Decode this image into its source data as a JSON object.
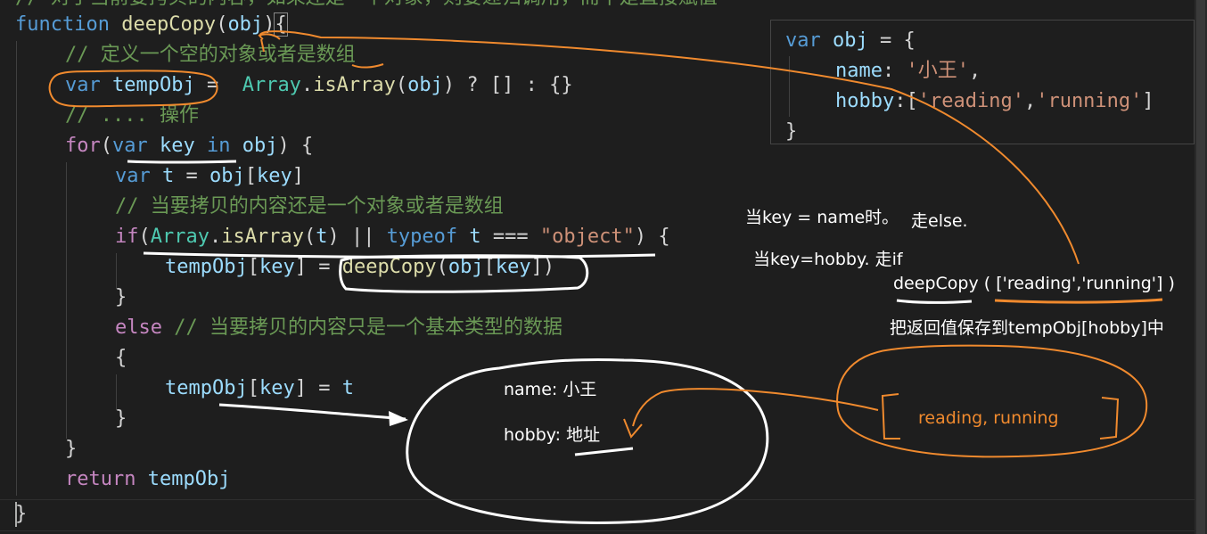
{
  "code": {
    "line0": "// 对于当前要拷贝的内容，如果还是一个对象，则要递归调用，而不是直接赋值",
    "line1": {
      "kw": "function",
      "fn": "deepCopy",
      "p1": "(",
      "v": "obj",
      "p2": ")",
      "brace": "{"
    },
    "line2": "// 定义一个空的对象或者是数组",
    "line3": {
      "kw": "var",
      "v": "tempObj",
      "op": " =  ",
      "cls": "Array",
      "dot": ".",
      "fn": "isArray",
      "p1": "(",
      "v2": "obj",
      "rest": ") ? [] : {}"
    },
    "line4": "// .... 操作",
    "line5": {
      "ctl": "for",
      "p1": "(",
      "kw": "var",
      "v": "key",
      "in": "in",
      "v2": "obj",
      "rest": ") {"
    },
    "line6": {
      "kw": "var",
      "v": "t",
      "op": " = ",
      "v2": "obj",
      "b1": "[",
      "v3": "key",
      "b2": "]"
    },
    "line7": "// 当要拷贝的内容还是一个对象或者是数组",
    "line8": {
      "ctl": "if",
      "p1": "(",
      "cls": "Array",
      "dot": ".",
      "fn": "isArray",
      "p2": "(",
      "v": "t",
      "p3": ") || ",
      "kw": "typeof",
      "v2": "t",
      "op": " === ",
      "str": "\"object\"",
      "rest": ") {"
    },
    "line9": {
      "v": "tempObj",
      "b1": "[",
      "v2": "key",
      "b2": "] = ",
      "fn": "deepCopy",
      "p1": "(",
      "v3": "obj",
      "b3": "[",
      "v4": "key",
      "rest": "])"
    },
    "line10": "}",
    "line11": {
      "ctl": "else",
      "cm": " // 当要拷贝的内容只是一个基本类型的数据"
    },
    "line12": "{",
    "line13": {
      "v": "tempObj",
      "b1": "[",
      "v2": "key",
      "b2": "] = ",
      "v3": "t"
    },
    "line14": "}",
    "line15": "}",
    "line16": {
      "ctl": "return",
      "v": "tempObj"
    },
    "line17": "}"
  },
  "popup": {
    "l1": {
      "kw": "var",
      "v": "obj",
      "rest": " = {"
    },
    "l2": {
      "v": "name",
      "op": ": ",
      "str": "'小王'",
      "rest": ","
    },
    "l3": {
      "v": "hobby",
      "op": ":[",
      "s1": "'reading'",
      "c": ",",
      "s2": "'running'",
      "rest": "]"
    },
    "l4": "}"
  },
  "notes": {
    "name_case_a": "当key = name时。",
    "name_case_b": "走else.",
    "hobby_case": "当key=hobby.  走if",
    "deepcopy_call": "deepCopy ( ['reading','running'] )",
    "save_note": "把返回值保存到tempObj[hobby]中",
    "circle_name": "name: 小王",
    "circle_hobby": "hobby: 地址",
    "array_box": "reading, running"
  },
  "colors": {
    "background": "#1e1e1e",
    "annotation_white": "#ffffff",
    "annotation_orange": "#f08a2e"
  }
}
